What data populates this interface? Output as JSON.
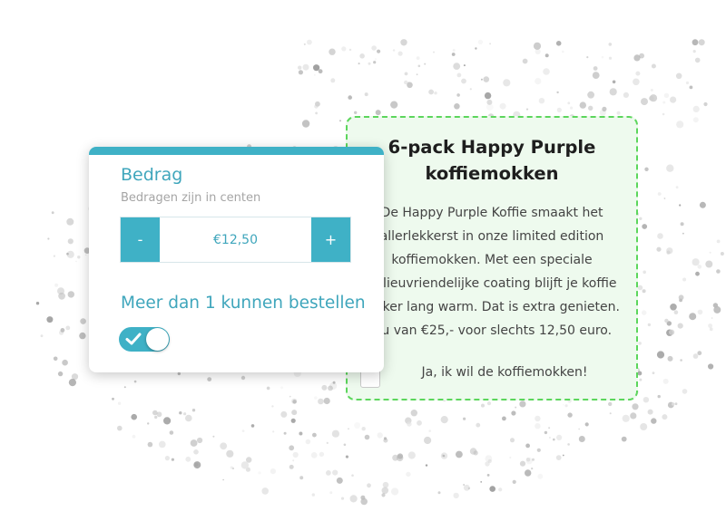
{
  "amount_widget": {
    "title": "Bedrag",
    "hint": "Bedragen zijn in centen",
    "stepper": {
      "minus_label": "-",
      "value": "€12,50",
      "plus_label": "+"
    },
    "multi_order_label": "Meer dan 1 kunnen bestellen",
    "multi_order_enabled": true
  },
  "product": {
    "title": "6-pack Happy Purple koffiemokken",
    "description": "De Happy Purple Koffie smaakt het allerlekkerst in onze limited edition koffiemokken. Met een speciale milieuvriendelijke coating blijft je koffie lekker lang warm. Dat is extra genieten. Nu van €25,- voor slechts 12,50 euro.",
    "checkbox_label": "Ja, ik wil de koffiemokken!",
    "checkbox_checked": false
  },
  "colors": {
    "accent": "#3fb1c6",
    "product_border": "#5cd65c",
    "product_bg": "#eefaee"
  }
}
